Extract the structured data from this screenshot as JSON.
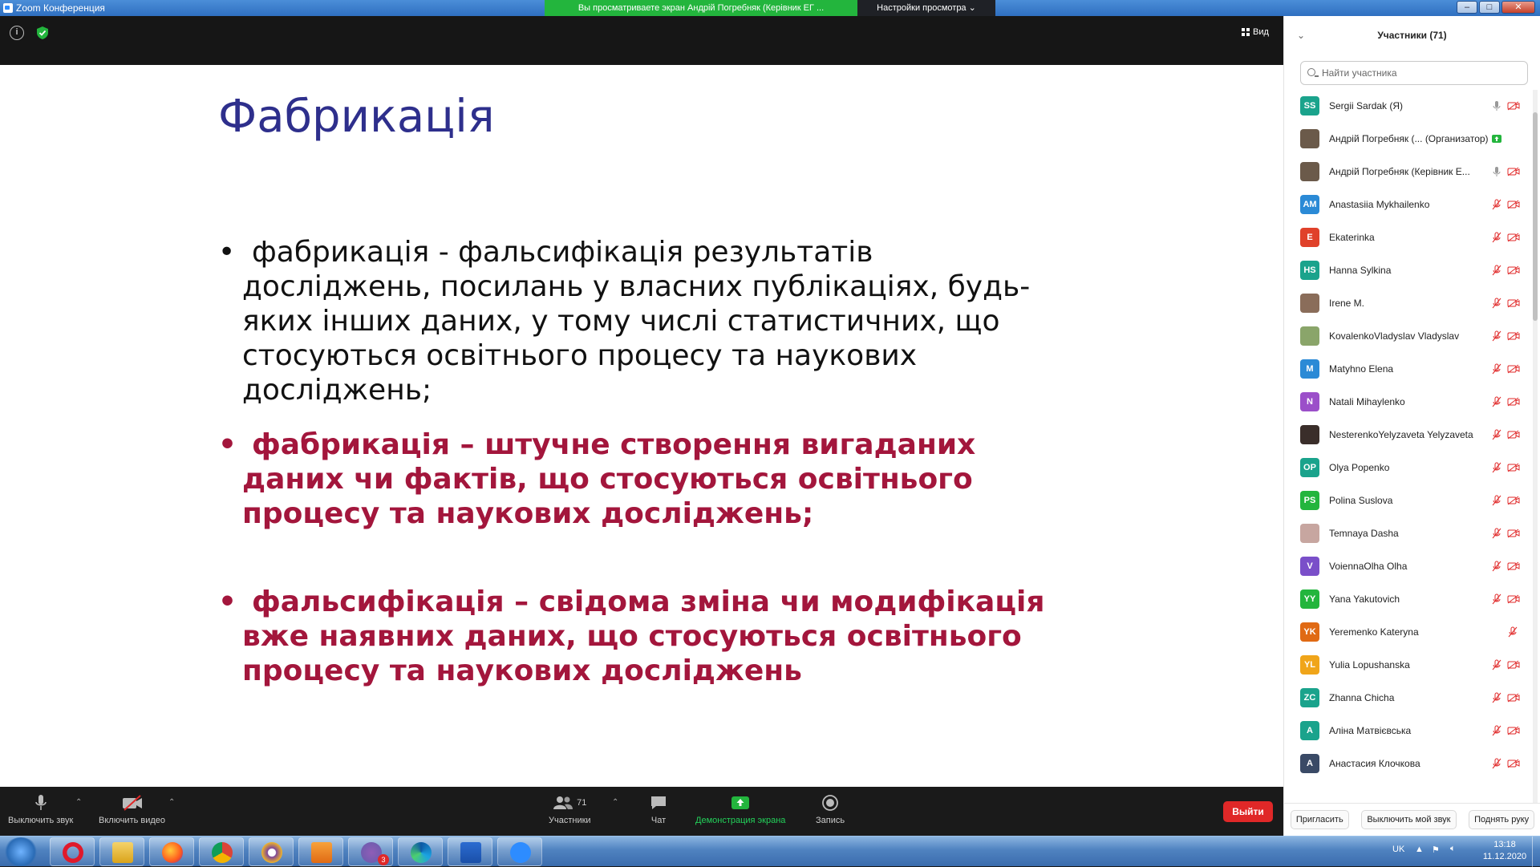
{
  "titlebar": {
    "app_title": "Zoom Конференция",
    "share_banner": "Вы просматриваете экран Андрій Погребняк (Керівник ЕГ ...",
    "view_settings": "Настройки просмотра ⌄"
  },
  "meeting_top": {
    "view_label": "Вид"
  },
  "slide": {
    "title": "Фабрикація",
    "bullets": [
      "фабрикація - фальсифікація результатів досліджень, посилань у власних публікаціях, будь-яких інших даних, у тому числі статистичних, що стосуються освітнього процесу та наукових досліджень;",
      "фабрикація – штучне створення вигаданих даних чи фактів, що стосуються освітнього процесу та наукових досліджень;",
      "фальсифікація – свідома зміна чи модифікація вже наявних даних, що стосуються освітнього процесу та наукових досліджень"
    ],
    "bullet_char": "•"
  },
  "toolbar": {
    "mute_label": "Выключить звук",
    "video_label": "Включить видео",
    "participants_label": "Участники",
    "participants_count": "71",
    "chat_label": "Чат",
    "share_label": "Демонстрация экрана",
    "record_label": "Запись",
    "leave_label": "Выйти"
  },
  "panel": {
    "header": "Участники (71)",
    "search_placeholder": "Найти участника",
    "participants": [
      {
        "initials": "SS",
        "name": "Sergii Sardak (Я)",
        "color": "#1aa38c",
        "mic": "on",
        "photo": false
      },
      {
        "initials": "",
        "name": "Андрій Погребняк (...  (Организатор)",
        "color": "#6b5a4a",
        "mic": "share",
        "photo": true
      },
      {
        "initials": "",
        "name": "Андрій Погребняк (Керівник Е...",
        "color": "#6b5a4a",
        "mic": "on",
        "photo": true
      },
      {
        "initials": "AM",
        "name": "Anastasiia Mykhailenko",
        "color": "#2b8ad6",
        "mic": "muted",
        "photo": false
      },
      {
        "initials": "E",
        "name": "Ekaterinka",
        "color": "#e0412a",
        "mic": "muted",
        "photo": false
      },
      {
        "initials": "HS",
        "name": "Hanna Sylkina",
        "color": "#1aa38c",
        "mic": "muted",
        "photo": false
      },
      {
        "initials": "",
        "name": "Irene M.",
        "color": "#8a6d5a",
        "mic": "muted",
        "photo": true
      },
      {
        "initials": "",
        "name": "KovalenkoVladyslav Vladyslav",
        "color": "#8aa56a",
        "mic": "muted",
        "photo": true
      },
      {
        "initials": "M",
        "name": "Matyhno Elena",
        "color": "#2b8ad6",
        "mic": "muted",
        "photo": false
      },
      {
        "initials": "N",
        "name": "Natali Mihaylenko",
        "color": "#9b4fc9",
        "mic": "muted",
        "photo": false
      },
      {
        "initials": "",
        "name": "NesterenkoYelyzaveta Yelyzaveta",
        "color": "#3a2e2a",
        "mic": "muted",
        "photo": true
      },
      {
        "initials": "OP",
        "name": "Olya Popenko",
        "color": "#1aa38c",
        "mic": "muted",
        "photo": false
      },
      {
        "initials": "PS",
        "name": "Polina Suslova",
        "color": "#23b53d",
        "mic": "muted",
        "photo": false
      },
      {
        "initials": "",
        "name": "Temnaya Dasha",
        "color": "#c7a6a0",
        "mic": "muted",
        "photo": true
      },
      {
        "initials": "V",
        "name": "VoiennaOlha Olha",
        "color": "#7a4fc9",
        "mic": "muted",
        "photo": false
      },
      {
        "initials": "YY",
        "name": "Yana Yakutovich",
        "color": "#23b53d",
        "mic": "muted",
        "photo": false
      },
      {
        "initials": "YK",
        "name": "Yeremenko Kateryna",
        "color": "#e06a14",
        "mic": "muted-nocam",
        "photo": false
      },
      {
        "initials": "YL",
        "name": "Yulia Lopushanska",
        "color": "#f0a51a",
        "mic": "muted",
        "photo": false
      },
      {
        "initials": "ZC",
        "name": "Zhanna Chicha",
        "color": "#1aa38c",
        "mic": "muted",
        "photo": false
      },
      {
        "initials": "A",
        "name": "Аліна Матвієвська",
        "color": "#1aa38c",
        "mic": "muted",
        "photo": false
      },
      {
        "initials": "A",
        "name": "Анастасия Клочкова",
        "color": "#3a4a66",
        "mic": "muted",
        "photo": false
      }
    ],
    "invite_label": "Пригласить",
    "mute_me_label": "Выключить мой звук",
    "raise_hand_label": "Поднять руку"
  },
  "taskbar": {
    "apps": [
      "opera-icon",
      "explorer-icon",
      "firefox-icon",
      "chrome-icon",
      "tor-icon",
      "media-player-icon",
      "viber-icon",
      "edge-icon",
      "word-icon",
      "zoom-icon"
    ],
    "viber_badge": "3",
    "lang": "UK",
    "time": "13:18",
    "date": "11.12.2020"
  },
  "colors": {
    "accent": "#2d8cff",
    "slide_title": "#2e2f8c",
    "slide_red": "#a3163c",
    "leave": "#e02828",
    "share_green": "#23b53d"
  }
}
